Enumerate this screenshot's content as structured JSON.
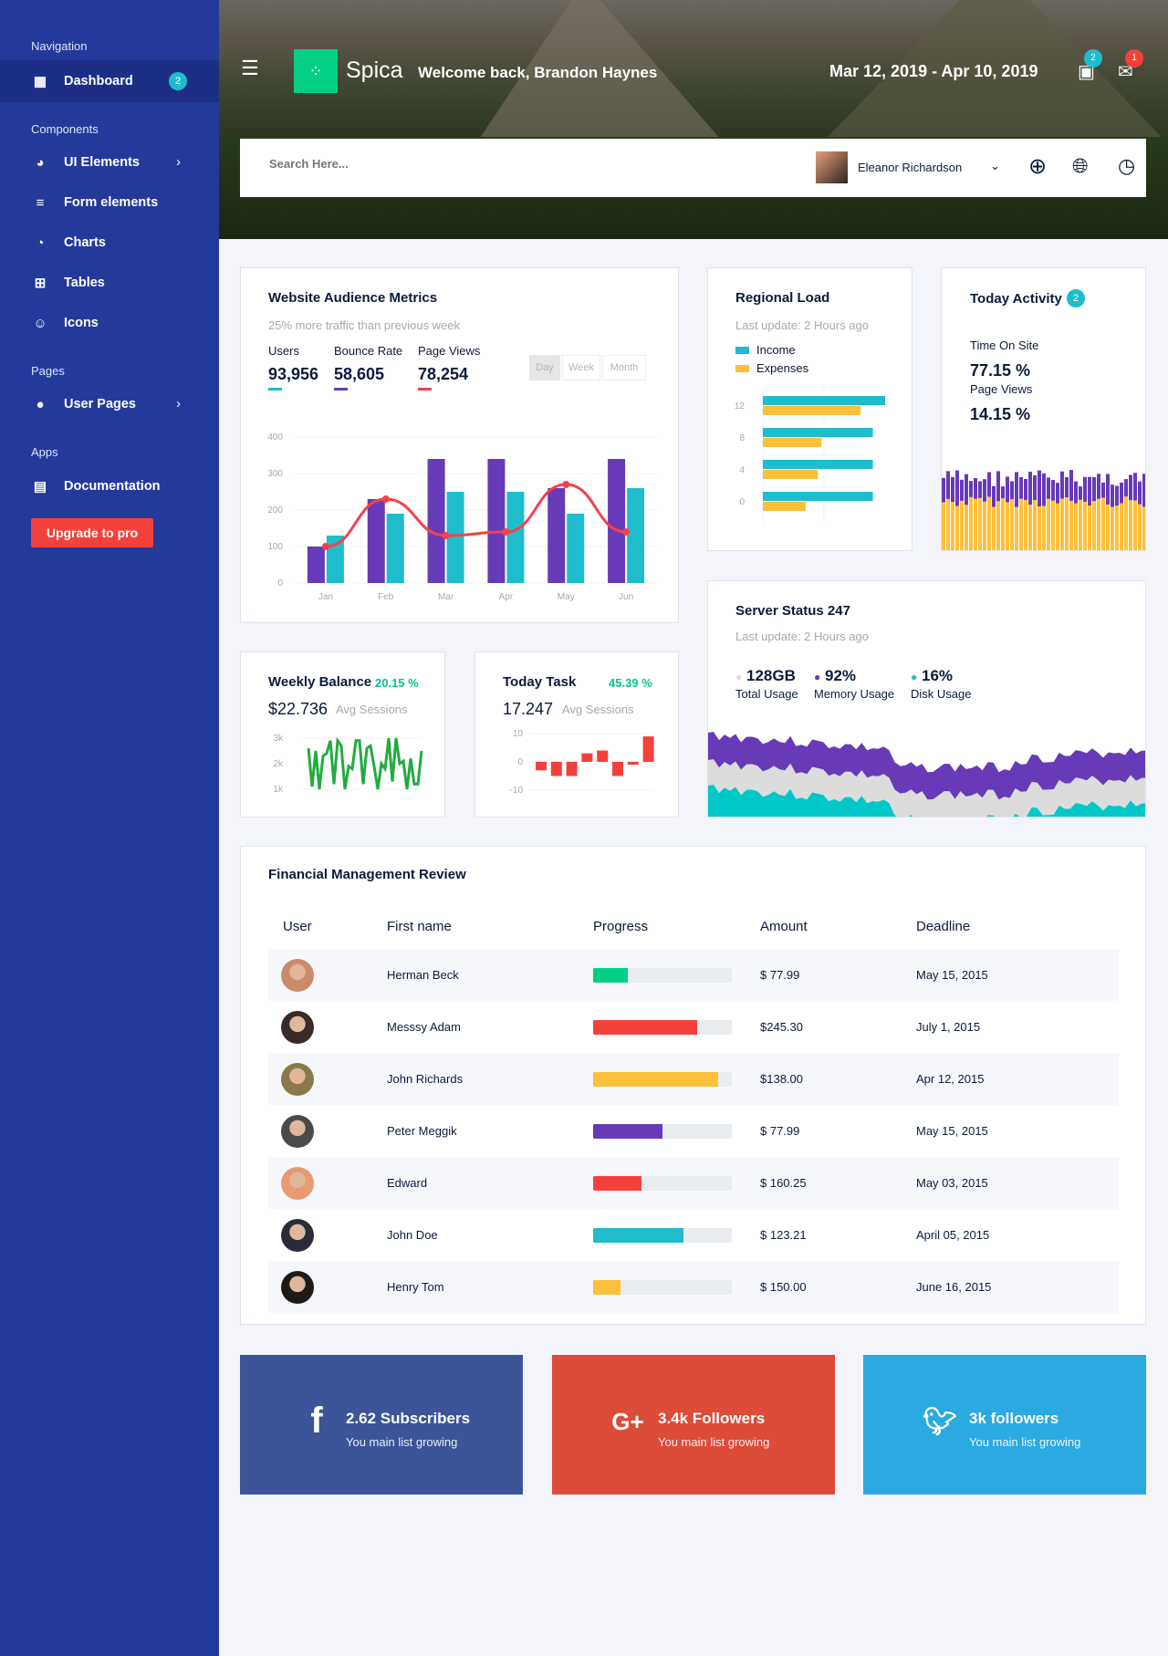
{
  "sidebar": {
    "sections": [
      "Navigation",
      "Components",
      "Pages",
      "Apps"
    ],
    "items": [
      {
        "label": "Dashboard",
        "icon": "dashboard-icon",
        "badge": "2"
      },
      {
        "label": "UI Elements",
        "icon": "palette-icon"
      },
      {
        "label": "Form elements",
        "icon": "list-icon"
      },
      {
        "label": "Charts",
        "icon": "pie-chart-icon"
      },
      {
        "label": "Tables",
        "icon": "grid-icon"
      },
      {
        "label": "Icons",
        "icon": "smiley-icon"
      },
      {
        "label": "User Pages",
        "icon": "user-icon"
      },
      {
        "label": "Documentation",
        "icon": "document-icon"
      }
    ],
    "upgrade": "Upgrade to pro"
  },
  "header": {
    "brand": "Spica",
    "welcome": "Welcome back, Brandon Haynes",
    "date_range": "Mar 12, 2019 - Apr 10, 2019",
    "notif1": "2",
    "notif2": "1",
    "search_placeholder": "Search Here...",
    "user": "Eleanor Richardson"
  },
  "colors": {
    "purple": "#673ab7",
    "teal": "#1fbccc",
    "red": "#f5414b",
    "yellow": "#fcc03a",
    "green": "#04d085",
    "sidebar": "#233a9b"
  },
  "audience": {
    "title": "Website Audience Metrics",
    "subtitle": "25% more traffic than previous week",
    "stats": [
      {
        "label": "Users",
        "value": "93,956"
      },
      {
        "label": "Bounce Rate",
        "value": "58,605"
      },
      {
        "label": "Page Views",
        "value": "78,254"
      }
    ],
    "ranges": [
      "Day",
      "Week",
      "Month"
    ]
  },
  "regional": {
    "title": "Regional Load",
    "subtitle": "Last update: 2 Hours ago",
    "legend": [
      "Income",
      "Expenses"
    ]
  },
  "activity": {
    "title": "Today Activity",
    "badge": "2",
    "m1_label": "Time On Site",
    "m1": "77.15 %",
    "m2_label": "Page Views",
    "m2": "14.15 %"
  },
  "weekly": {
    "title": "Weekly Balance",
    "pct": "20.15 %",
    "value": "$22.736",
    "sub": "Avg Sessions"
  },
  "task": {
    "title": "Today Task",
    "pct": "45.39 %",
    "value": "17.247",
    "sub": "Avg Sessions"
  },
  "server": {
    "title": "Server Status 247",
    "subtitle": "Last update: 2 Hours ago",
    "stats": [
      {
        "value": "128GB",
        "label": "Total Usage"
      },
      {
        "value": "92%",
        "label": "Memory Usage"
      },
      {
        "value": "16%",
        "label": "Disk Usage"
      }
    ]
  },
  "table": {
    "title": "Financial Management Review",
    "headers": [
      "User",
      "First name",
      "Progress",
      "Amount",
      "Deadline"
    ],
    "rows": [
      {
        "name": "Herman Beck",
        "progress": 25,
        "color": "#04d085",
        "amount": "$ 77.99",
        "deadline": "May 15, 2015"
      },
      {
        "name": "Messsy Adam",
        "progress": 75,
        "color": "#f5413b",
        "amount": "$245.30",
        "deadline": "July 1, 2015"
      },
      {
        "name": "John Richards",
        "progress": 90,
        "color": "#fcc03a",
        "amount": "$138.00",
        "deadline": "Apr 12, 2015"
      },
      {
        "name": "Peter Meggik",
        "progress": 50,
        "color": "#673ab7",
        "amount": "$ 77.99",
        "deadline": "May 15, 2015"
      },
      {
        "name": "Edward",
        "progress": 35,
        "color": "#f5413b",
        "amount": "$ 160.25",
        "deadline": "May 03, 2015"
      },
      {
        "name": "John Doe",
        "progress": 65,
        "color": "#1fbccc",
        "amount": "$ 123.21",
        "deadline": "April 05, 2015"
      },
      {
        "name": "Henry Tom",
        "progress": 20,
        "color": "#fcc03a",
        "amount": "$ 150.00",
        "deadline": "June 16, 2015"
      }
    ]
  },
  "social": [
    {
      "title": "2.62 Subscribers",
      "sub": "You main list growing",
      "icon": "facebook-icon",
      "color": "#3b5598"
    },
    {
      "title": "3.4k Followers",
      "sub": "You main list growing",
      "icon": "google-plus-icon",
      "color": "#dd4b39"
    },
    {
      "title": "3k followers",
      "sub": "You main list growing",
      "icon": "twitter-icon",
      "color": "#2ba9e1"
    }
  ],
  "chart_data": [
    {
      "type": "bar",
      "categories": [
        "Jan",
        "Feb",
        "Mar",
        "Apr",
        "May",
        "Jun"
      ],
      "ylim": [
        0,
        400
      ],
      "yticks": [
        0,
        100,
        200,
        300,
        400
      ],
      "series": [
        {
          "values": [
            100,
            230,
            340,
            340,
            260,
            340
          ],
          "color": "#673ab7"
        },
        {
          "values": [
            130,
            190,
            250,
            250,
            190,
            260
          ],
          "color": "#1fbccc"
        },
        {
          "type": "line",
          "values": [
            100,
            230,
            130,
            140,
            270,
            140
          ],
          "color": "#f5414b"
        }
      ]
    },
    {
      "type": "bar",
      "orientation": "horizontal",
      "categories": [
        "12",
        "8",
        "4",
        "0"
      ],
      "series": [
        {
          "name": "Income",
          "values": [
            10,
            9,
            9,
            9
          ]
        },
        {
          "name": "Expenses",
          "values": [
            8,
            4.8,
            4.5,
            3.5
          ]
        }
      ]
    },
    {
      "type": "line",
      "yticks": [
        "3k",
        "2k",
        "1k"
      ],
      "ylim": [
        1,
        3
      ],
      "values": [
        2.6,
        1.1,
        2.5,
        1.0,
        2.3,
        2.4,
        2.9,
        1.2,
        2.9,
        2.7,
        1.0,
        1.9,
        1.8,
        2.9,
        2.9,
        1.2,
        2.6,
        2.7,
        1.9,
        1.0,
        2.0,
        1.8,
        3.0,
        1.3,
        3.0,
        2.0,
        2.1,
        1.0,
        2.2,
        1.2,
        1.2,
        2.5
      ]
    },
    {
      "type": "bar",
      "yticks": [
        10,
        0,
        -10
      ],
      "ylim": [
        -10,
        10
      ],
      "values": [
        -3,
        -5,
        -5,
        3,
        4,
        -5,
        -1,
        9
      ]
    }
  ]
}
